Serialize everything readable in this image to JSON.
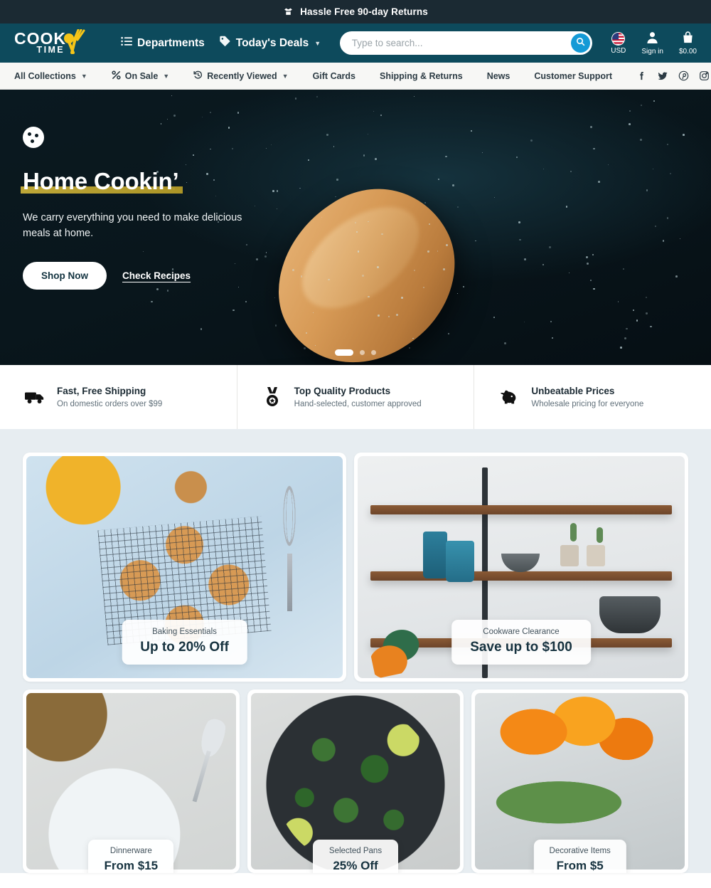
{
  "announcement": {
    "text": "Hassle Free 90-day Returns",
    "icon": "box-open-icon"
  },
  "header": {
    "logo": {
      "line1": "COOK",
      "line2": "TIME",
      "icon": "fork-spoon-icon"
    },
    "nav": [
      {
        "label": "Departments",
        "icon": "list-icon",
        "caret": false
      },
      {
        "label": "Today's Deals",
        "icon": "tag-icon",
        "caret": true
      }
    ],
    "search": {
      "placeholder": "Type to search...",
      "value": "",
      "icon": "search-icon"
    },
    "currency": {
      "label": "USD",
      "icon": "us-flag-icon",
      "caret": "▾"
    },
    "account": {
      "label": "Sign in",
      "icon": "user-icon"
    },
    "cart": {
      "label": "$0.00",
      "icon": "shopping-bag-icon"
    }
  },
  "subnav": {
    "items": [
      {
        "label": "All Collections",
        "icon": "",
        "caret": true
      },
      {
        "label": "On Sale",
        "icon": "percent-icon",
        "caret": true
      },
      {
        "label": "Recently Viewed",
        "icon": "history-icon",
        "caret": true
      },
      {
        "label": "Gift Cards",
        "icon": "",
        "caret": false
      },
      {
        "label": "Shipping & Returns",
        "icon": "",
        "caret": false
      },
      {
        "label": "News",
        "icon": "",
        "caret": false
      },
      {
        "label": "Customer Support",
        "icon": "",
        "caret": false
      }
    ],
    "social": [
      "facebook-icon",
      "twitter-icon",
      "pinterest-icon",
      "instagram-icon"
    ]
  },
  "hero": {
    "icon": "cookie-icon",
    "title": "Home Cookin’",
    "subtitle": "We carry everything you need to make delicious meals at home.",
    "primary_cta": "Shop Now",
    "secondary_cta": "Check Recipes",
    "slides": 3,
    "active_slide": 1
  },
  "features": [
    {
      "icon": "truck-icon",
      "title": "Fast, Free Shipping",
      "subtitle": "On domestic orders over $99"
    },
    {
      "icon": "medal-icon",
      "title": "Top Quality Products",
      "subtitle": "Hand-selected, customer approved"
    },
    {
      "icon": "piggy-bank-icon",
      "title": "Unbeatable Prices",
      "subtitle": "Wholesale pricing for everyone"
    }
  ],
  "promos": {
    "row1": [
      {
        "kicker": "Baking Essentials",
        "main": "Up to 20% Off",
        "image": "cookies-on-rack"
      },
      {
        "kicker": "Cookware Clearance",
        "main": "Save up to $100",
        "image": "kitchen-shelves"
      }
    ],
    "row2": [
      {
        "kicker": "Dinnerware",
        "main": "From $15",
        "image": "pumpkin-soup-bowls"
      },
      {
        "kicker": "Selected Pans",
        "main": "25% Off",
        "image": "rice-skillet"
      },
      {
        "kicker": "Decorative Items",
        "main": "From $5",
        "image": "orange-tulips"
      }
    ]
  },
  "colors": {
    "header_teal": "#0d4a5c",
    "announce_navy": "#1b2a33",
    "search_button_blue": "#149ad6",
    "promo_background": "#e7edf1",
    "accent_yellow": "#cdb33a"
  }
}
